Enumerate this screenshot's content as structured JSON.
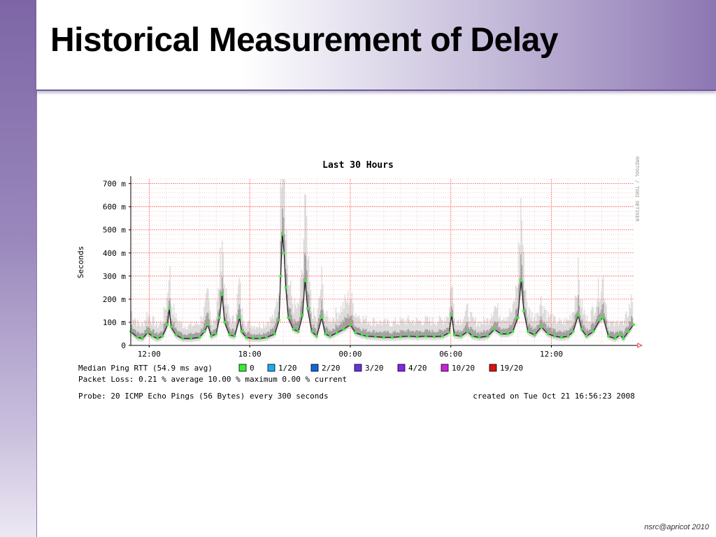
{
  "slide": {
    "title": "Historical Measurement of Delay",
    "footer": "nsrc@apricot 2010"
  },
  "chart_data": {
    "type": "line",
    "title": "Last 30 Hours",
    "ylabel": "Seconds",
    "watermark": "RRDTOOL / TOBI OETIKER",
    "ylim": [
      0,
      720
    ],
    "y_ticks": [
      {
        "value": 0,
        "label": "0"
      },
      {
        "value": 100,
        "label": "100 m"
      },
      {
        "value": 200,
        "label": "200 m"
      },
      {
        "value": 300,
        "label": "300 m"
      },
      {
        "value": 400,
        "label": "400 m"
      },
      {
        "value": 500,
        "label": "500 m"
      },
      {
        "value": 600,
        "label": "600 m"
      },
      {
        "value": 700,
        "label": "700 m"
      }
    ],
    "x_range_hours": [
      10.9,
      40.9
    ],
    "x_ticks": [
      {
        "hour": 12,
        "label": "12:00"
      },
      {
        "hour": 18,
        "label": "18:00"
      },
      {
        "hour": 24,
        "label": "00:00"
      },
      {
        "hour": 30,
        "label": "06:00"
      },
      {
        "hour": 36,
        "label": "12:00"
      }
    ],
    "series": [
      {
        "name": "Median Ping RTT",
        "color": "#33ee33",
        "points": [
          [
            10.9,
            60
          ],
          [
            11.3,
            35
          ],
          [
            11.6,
            30
          ],
          [
            11.9,
            55
          ],
          [
            12.2,
            40
          ],
          [
            12.5,
            30
          ],
          [
            12.8,
            40
          ],
          [
            13.1,
            90
          ],
          [
            13.2,
            160
          ],
          [
            13.3,
            80
          ],
          [
            13.6,
            45
          ],
          [
            14.0,
            30
          ],
          [
            14.5,
            30
          ],
          [
            15.0,
            35
          ],
          [
            15.3,
            60
          ],
          [
            15.5,
            90
          ],
          [
            15.7,
            40
          ],
          [
            16.0,
            50
          ],
          [
            16.2,
            120
          ],
          [
            16.35,
            220
          ],
          [
            16.5,
            100
          ],
          [
            16.8,
            45
          ],
          [
            17.1,
            40
          ],
          [
            17.4,
            120
          ],
          [
            17.5,
            60
          ],
          [
            17.8,
            35
          ],
          [
            18.2,
            30
          ],
          [
            18.6,
            30
          ],
          [
            19.0,
            35
          ],
          [
            19.5,
            50
          ],
          [
            19.75,
            110
          ],
          [
            19.85,
            300
          ],
          [
            19.95,
            480
          ],
          [
            20.05,
            400
          ],
          [
            20.15,
            250
          ],
          [
            20.3,
            120
          ],
          [
            20.6,
            70
          ],
          [
            20.9,
            60
          ],
          [
            21.15,
            130
          ],
          [
            21.3,
            280
          ],
          [
            21.45,
            160
          ],
          [
            21.7,
            60
          ],
          [
            22.0,
            40
          ],
          [
            22.3,
            120
          ],
          [
            22.5,
            50
          ],
          [
            22.8,
            40
          ],
          [
            23.2,
            55
          ],
          [
            23.6,
            70
          ],
          [
            24.0,
            90
          ],
          [
            24.3,
            55
          ],
          [
            24.7,
            45
          ],
          [
            25.0,
            40
          ],
          [
            25.5,
            38
          ],
          [
            26.0,
            35
          ],
          [
            26.5,
            35
          ],
          [
            27.0,
            38
          ],
          [
            27.5,
            40
          ],
          [
            28.0,
            38
          ],
          [
            28.5,
            40
          ],
          [
            29.0,
            38
          ],
          [
            29.5,
            40
          ],
          [
            29.9,
            55
          ],
          [
            30.05,
            130
          ],
          [
            30.2,
            45
          ],
          [
            30.6,
            40
          ],
          [
            31.0,
            60
          ],
          [
            31.3,
            40
          ],
          [
            31.7,
            35
          ],
          [
            32.2,
            40
          ],
          [
            32.6,
            70
          ],
          [
            33.0,
            50
          ],
          [
            33.4,
            50
          ],
          [
            33.7,
            60
          ],
          [
            34.0,
            120
          ],
          [
            34.2,
            280
          ],
          [
            34.35,
            150
          ],
          [
            34.6,
            60
          ],
          [
            35.0,
            45
          ],
          [
            35.4,
            80
          ],
          [
            35.8,
            50
          ],
          [
            36.2,
            40
          ],
          [
            36.6,
            35
          ],
          [
            37.0,
            40
          ],
          [
            37.3,
            60
          ],
          [
            37.6,
            130
          ],
          [
            37.8,
            70
          ],
          [
            38.1,
            40
          ],
          [
            38.5,
            60
          ],
          [
            38.9,
            110
          ],
          [
            39.1,
            120
          ],
          [
            39.4,
            40
          ],
          [
            39.8,
            30
          ],
          [
            40.1,
            45
          ],
          [
            40.3,
            30
          ],
          [
            40.6,
            60
          ],
          [
            40.9,
            90
          ]
        ]
      }
    ],
    "legend": [
      {
        "label": "0",
        "color": "#33ee33"
      },
      {
        "label": "1/20",
        "color": "#22aaee"
      },
      {
        "label": "2/20",
        "color": "#1166dd"
      },
      {
        "label": "3/20",
        "color": "#6633dd"
      },
      {
        "label": "4/20",
        "color": "#8822ee"
      },
      {
        "label": "10/20",
        "color": "#cc22dd"
      },
      {
        "label": "19/20",
        "color": "#dd1111"
      }
    ],
    "legend_lead": "Median Ping RTT (54.9 ms avg)",
    "packet_loss_text": "Packet Loss: 0.21 % average  10.00 % maximum  0.00 % current",
    "probe_text": "Probe: 20 ICMP Echo Pings (56 Bytes) every 300 seconds",
    "created_text": "created on Tue Oct 21 16:56:23 2008",
    "grid": true
  }
}
